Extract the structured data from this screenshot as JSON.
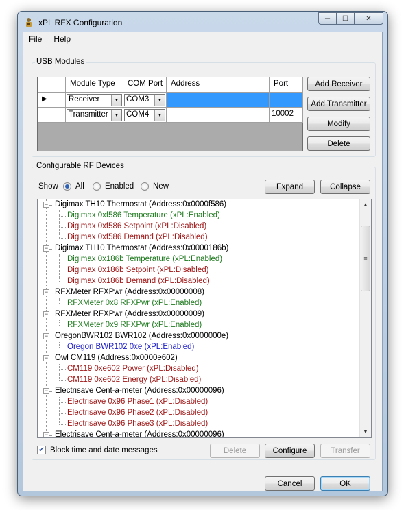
{
  "window": {
    "title": "xPL RFX Configuration"
  },
  "menu": [
    "File",
    "Help"
  ],
  "usb_modules": {
    "group_label": "USB Modules",
    "columns": [
      "Module Type",
      "COM Port",
      "Address",
      "Port"
    ],
    "rows": [
      {
        "module_type": "Receiver",
        "com_port": "COM3",
        "address": "",
        "port": "",
        "selected": true
      },
      {
        "module_type": "Transmitter",
        "com_port": "COM4",
        "address": "",
        "port": "10002",
        "selected": false
      }
    ],
    "buttons": {
      "add_receiver": "Add Receiver",
      "add_transmitter": "Add Transmitter",
      "modify": "Modify",
      "delete": "Delete"
    }
  },
  "rf_devices": {
    "group_label": "Configurable RF Devices",
    "show_label": "Show",
    "filters": {
      "all": "All",
      "enabled": "Enabled",
      "new": "New",
      "selected": "All"
    },
    "expand": "Expand",
    "collapse": "Collapse",
    "tree": [
      {
        "label": "Digimax TH10 Thermostat (Address:0x0000f586)",
        "children": [
          {
            "label": "Digimax 0xf586 Temperature (xPL:Enabled)",
            "color": "green"
          },
          {
            "label": "Digimax 0xf586 Setpoint (xPL:Disabled)",
            "color": "red"
          },
          {
            "label": "Digimax 0xf586 Demand (xPL:Disabled)",
            "color": "red"
          }
        ]
      },
      {
        "label": "Digimax TH10 Thermostat (Address:0x0000186b)",
        "children": [
          {
            "label": "Digimax 0x186b Temperature (xPL:Enabled)",
            "color": "green"
          },
          {
            "label": "Digimax 0x186b Setpoint (xPL:Disabled)",
            "color": "red"
          },
          {
            "label": "Digimax 0x186b Demand (xPL:Disabled)",
            "color": "red"
          }
        ]
      },
      {
        "label": "RFXMeter RFXPwr (Address:0x00000008)",
        "children": [
          {
            "label": "RFXMeter 0x8 RFXPwr (xPL:Enabled)",
            "color": "green"
          }
        ]
      },
      {
        "label": "RFXMeter RFXPwr (Address:0x00000009)",
        "children": [
          {
            "label": "RFXMeter 0x9 RFXPwr (xPL:Enabled)",
            "color": "green"
          }
        ]
      },
      {
        "label": "OregonBWR102 BWR102 (Address:0x0000000e)",
        "children": [
          {
            "label": "Oregon BWR102 0xe (xPL:Enabled)",
            "color": "blue"
          }
        ]
      },
      {
        "label": "Owl CM119 (Address:0x0000e602)",
        "children": [
          {
            "label": "CM119 0xe602 Power (xPL:Disabled)",
            "color": "red"
          },
          {
            "label": "CM119 0xe602 Energy (xPL:Disabled)",
            "color": "red"
          }
        ]
      },
      {
        "label": "Electrisave Cent-a-meter (Address:0x00000096)",
        "children": [
          {
            "label": "Electrisave 0x96 Phase1 (xPL:Disabled)",
            "color": "red"
          },
          {
            "label": "Electrisave 0x96 Phase2 (xPL:Disabled)",
            "color": "red"
          },
          {
            "label": "Electrisave 0x96 Phase3 (xPL:Disabled)",
            "color": "red"
          }
        ]
      },
      {
        "label": "Electrisave Cent-a-meter (Address:0x00000096)",
        "children": []
      }
    ],
    "block_messages": {
      "label": "Block time and date messages",
      "checked": true
    },
    "actions": {
      "delete": "Delete",
      "configure": "Configure",
      "transfer": "Transfer"
    }
  },
  "dialog": {
    "cancel": "Cancel",
    "ok": "OK"
  },
  "colors": {
    "enabled": "#1f7a1f",
    "disabled": "#a01818",
    "new": "#1a1ac8",
    "selection": "#3399ff"
  },
  "icons": [
    "app-icon",
    "minimize-icon",
    "maximize-icon",
    "close-icon",
    "row-pointer-icon",
    "dropdown-arrow-icon",
    "expander-minus-icon",
    "scroll-up-icon",
    "scroll-down-icon",
    "checkmark-icon"
  ]
}
